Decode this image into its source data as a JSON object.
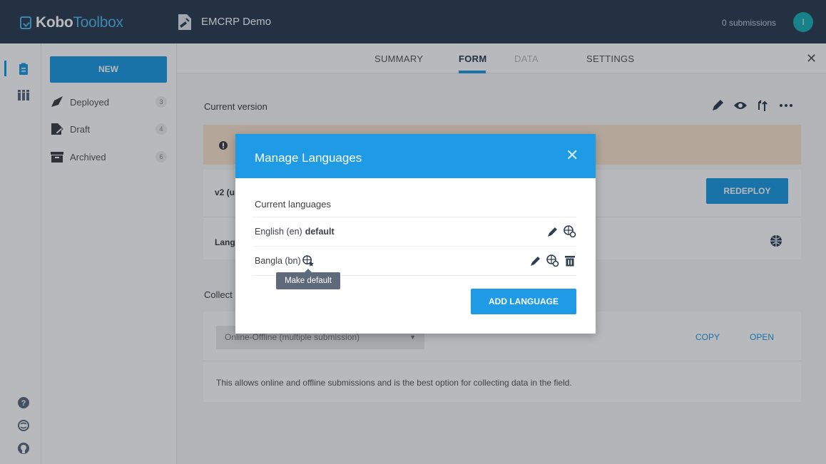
{
  "app": {
    "logo_bold": "Kobo",
    "logo_light": "Toolbox",
    "project_title": "EMCRP Demo",
    "submissions": "0 submissions",
    "avatar_initial": "I"
  },
  "sidebar": {
    "new_label": "NEW",
    "items": [
      {
        "label": "Deployed",
        "count": "3",
        "icon": "rocket-icon"
      },
      {
        "label": "Draft",
        "count": "4",
        "icon": "draft-icon"
      },
      {
        "label": "Archived",
        "count": "6",
        "icon": "archive-icon"
      }
    ]
  },
  "rail": {
    "icons": [
      "forms-icon",
      "library-icon",
      "help-icon",
      "support-icon",
      "github-icon"
    ]
  },
  "tabs": [
    {
      "label": "SUMMARY"
    },
    {
      "label": "FORM"
    },
    {
      "label": "DATA"
    },
    {
      "label": "SETTINGS"
    }
  ],
  "form": {
    "current_version": "Current version",
    "version_prefix": "v2 (u",
    "languages_prefix": "Lang",
    "collect_prefix": "Collect",
    "redeploy": "REDEPLOY",
    "collect_select": "Online-Offline (multiple submission)",
    "copy": "COPY",
    "open": "OPEN",
    "description": "This allows online and offline submissions and is the best option for collecting data in the field."
  },
  "modal": {
    "title": "Manage Languages",
    "current_languages": "Current languages",
    "languages": [
      {
        "name": "English (en)",
        "tag": "default"
      },
      {
        "name": "Bangla (bn)",
        "tag": ""
      }
    ],
    "add_language": "ADD LANGUAGE",
    "tooltip": "Make default"
  },
  "colors": {
    "header": "#2d3d52",
    "accent": "#1e9be4",
    "alert": "#fbe6cf"
  }
}
